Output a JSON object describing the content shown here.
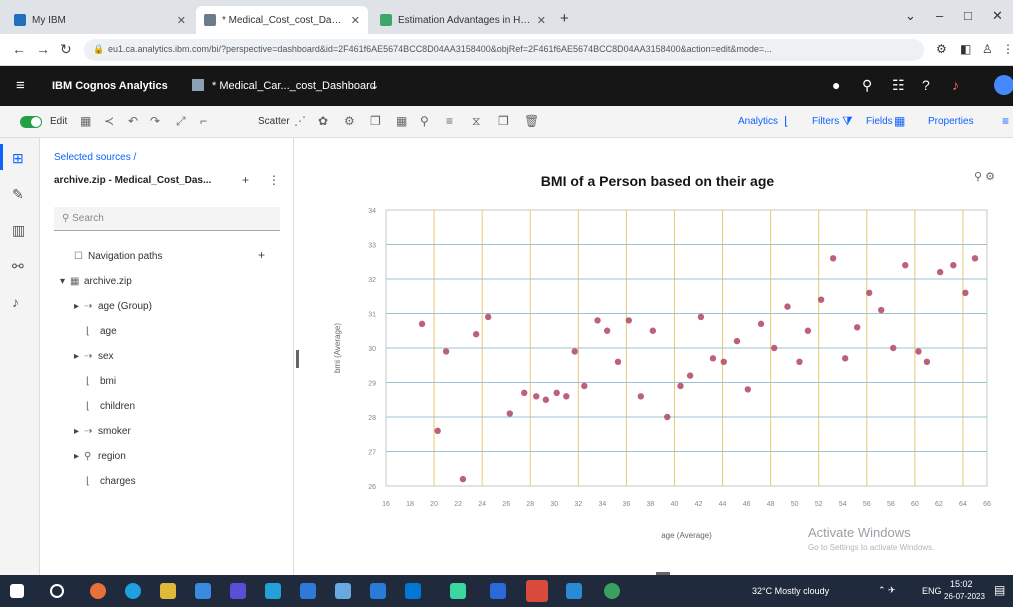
{
  "browser": {
    "tabs": [
      {
        "label": "My IBM",
        "fav": "#1f70c1"
      },
      {
        "label": "* Medical_Cost_cost_Dashboard",
        "fav": "#6b7b8c"
      },
      {
        "label": "Estimation Advantages in Health",
        "fav": "#3fa66b"
      }
    ],
    "new_tab": "+",
    "url": "eu1.ca.analytics.ibm.com/bi/?perspective=dashboard&id=2F461f6AE5674BCC8D04AA3158400&objRef=2F461f6AE5674BCC8D04AA3158400&action=edit&mode=..."
  },
  "app": {
    "brand": "IBM Cognos Analytics",
    "doc_title": "* Medical_Car..._cost_Dashboard"
  },
  "toolbar": {
    "edit": "Edit",
    "scatter": "Scatter",
    "analytics": "Analytics",
    "filters": "Filters",
    "fields": "Fields",
    "properties": "Properties"
  },
  "panel": {
    "breadcrumb": "Selected sources  /",
    "source_name": "archive.zip - Medical_Cost_Das...",
    "search_placeholder": "Search",
    "tree": {
      "navigation_paths": "Navigation paths",
      "archive": "archive.zip",
      "age_group": "age (Group)",
      "age": "age",
      "sex": "sex",
      "bmi": "bmi",
      "children": "children",
      "smoker": "smoker",
      "region": "region",
      "charges": "charges"
    }
  },
  "chart_data": {
    "type": "scatter",
    "title": "BMI of a Person based on their age",
    "xlabel": "age (Average)",
    "ylabel": "bmi (Average)",
    "xlim": [
      16,
      66
    ],
    "ylim": [
      26,
      34
    ],
    "x_ticks": [
      "16",
      "18",
      "20",
      "22",
      "24",
      "26",
      "28",
      "30",
      "32",
      "34",
      "36",
      "38",
      "40",
      "42",
      "44",
      "46",
      "48",
      "50",
      "52",
      "54",
      "56",
      "58",
      "60",
      "62",
      "64",
      "66"
    ],
    "y_ticks": [
      "26",
      "27",
      "28",
      "29",
      "30",
      "31",
      "32",
      "33",
      "34"
    ],
    "grid": true,
    "points": [
      {
        "x": 19,
        "y": 30.7
      },
      {
        "x": 20.3,
        "y": 27.6
      },
      {
        "x": 21,
        "y": 29.9
      },
      {
        "x": 22.4,
        "y": 26.2
      },
      {
        "x": 23.5,
        "y": 30.4
      },
      {
        "x": 24.5,
        "y": 30.9
      },
      {
        "x": 26.3,
        "y": 28.1
      },
      {
        "x": 27.5,
        "y": 28.7
      },
      {
        "x": 28.5,
        "y": 28.6
      },
      {
        "x": 29.3,
        "y": 28.5
      },
      {
        "x": 30.2,
        "y": 28.7
      },
      {
        "x": 31,
        "y": 28.6
      },
      {
        "x": 31.7,
        "y": 29.9
      },
      {
        "x": 32.5,
        "y": 28.9
      },
      {
        "x": 33.6,
        "y": 30.8
      },
      {
        "x": 34.4,
        "y": 30.5
      },
      {
        "x": 35.3,
        "y": 29.6
      },
      {
        "x": 36.2,
        "y": 30.8
      },
      {
        "x": 37.2,
        "y": 28.6
      },
      {
        "x": 38.2,
        "y": 30.5
      },
      {
        "x": 39.4,
        "y": 28.0
      },
      {
        "x": 40.5,
        "y": 28.9
      },
      {
        "x": 41.3,
        "y": 29.2
      },
      {
        "x": 42.2,
        "y": 30.9
      },
      {
        "x": 43.2,
        "y": 29.7
      },
      {
        "x": 44.1,
        "y": 29.6
      },
      {
        "x": 45.2,
        "y": 30.2
      },
      {
        "x": 46.1,
        "y": 28.8
      },
      {
        "x": 47.2,
        "y": 30.7
      },
      {
        "x": 48.3,
        "y": 30.0
      },
      {
        "x": 49.4,
        "y": 31.2
      },
      {
        "x": 50.4,
        "y": 29.6
      },
      {
        "x": 51.1,
        "y": 30.5
      },
      {
        "x": 52.2,
        "y": 31.4
      },
      {
        "x": 53.2,
        "y": 32.6
      },
      {
        "x": 54.2,
        "y": 29.7
      },
      {
        "x": 55.2,
        "y": 30.6
      },
      {
        "x": 56.2,
        "y": 31.6
      },
      {
        "x": 57.2,
        "y": 31.1
      },
      {
        "x": 58.2,
        "y": 30.0
      },
      {
        "x": 59.2,
        "y": 32.4
      },
      {
        "x": 60.3,
        "y": 29.9
      },
      {
        "x": 61,
        "y": 29.6
      },
      {
        "x": 62.1,
        "y": 32.2
      },
      {
        "x": 63.2,
        "y": 32.4
      },
      {
        "x": 64.2,
        "y": 31.6
      },
      {
        "x": 65,
        "y": 32.6
      }
    ],
    "colors": {
      "point": "#b5506b",
      "grid_v": "#e9c96a",
      "grid_h": "#9cc1d1"
    }
  },
  "watermark": {
    "title": "Activate Windows",
    "subtitle": "Go to Settings to activate Windows."
  },
  "tray": {
    "weather": "32°C  Mostly cloudy",
    "lang": "ENG",
    "time": "15:02",
    "date": "26-07-2023"
  }
}
